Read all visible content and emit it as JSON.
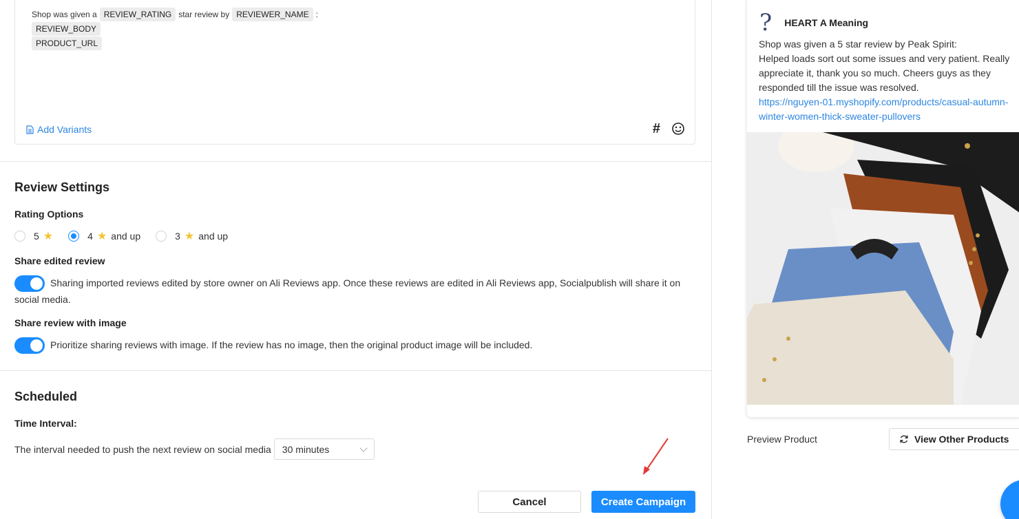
{
  "editor": {
    "template_prefix": "Shop was given a",
    "chip_rating": "REVIEW_RATING",
    "template_mid": "star review by",
    "chip_reviewer": "REVIEWER_NAME",
    "template_colon": ":",
    "chip_body": "REVIEW_BODY",
    "chip_url": "PRODUCT_URL",
    "add_variants_label": "Add Variants",
    "hash_label": "#"
  },
  "review_settings": {
    "title": "Review Settings",
    "rating_options_label": "Rating Options",
    "options": [
      {
        "value": "5",
        "suffix": "",
        "checked": false
      },
      {
        "value": "4",
        "suffix": "and up",
        "checked": true
      },
      {
        "value": "3",
        "suffix": "and up",
        "checked": false
      }
    ],
    "share_edited_label": "Share edited review",
    "share_edited_text": "Sharing imported reviews edited by store owner on Ali Reviews app. Once these reviews are edited in Ali Reviews app, Socialpublish will share it on social media.",
    "share_image_label": "Share review with image",
    "share_image_text": "Prioritize sharing reviews with image. If the review has no image, then the original product image will be included."
  },
  "scheduled": {
    "title": "Scheduled",
    "time_interval_label": "Time Interval:",
    "interval_text": "The interval needed to push the next review on social media",
    "interval_value": "30 minutes"
  },
  "buttons": {
    "cancel": "Cancel",
    "create": "Create Campaign"
  },
  "preview": {
    "shop_name": "HEART A Meaning",
    "line1": "Shop was given a 5 star review by Peak Spirit:",
    "line2": "Helped loads sort out some issues and very patient. Really appreciate it, thank you so much. Cheers guys as they responded till the issue was resolved.",
    "link": "https://nguyen-01.myshopify.com/products/casual-autumn-winter-women-thick-sweater-pullovers",
    "preview_product_label": "Preview Product",
    "view_other_label": "View Other Products"
  },
  "colors": {
    "accent": "#1a8cff",
    "link": "#2c86e0",
    "annotation_arrow": "#e53935"
  }
}
